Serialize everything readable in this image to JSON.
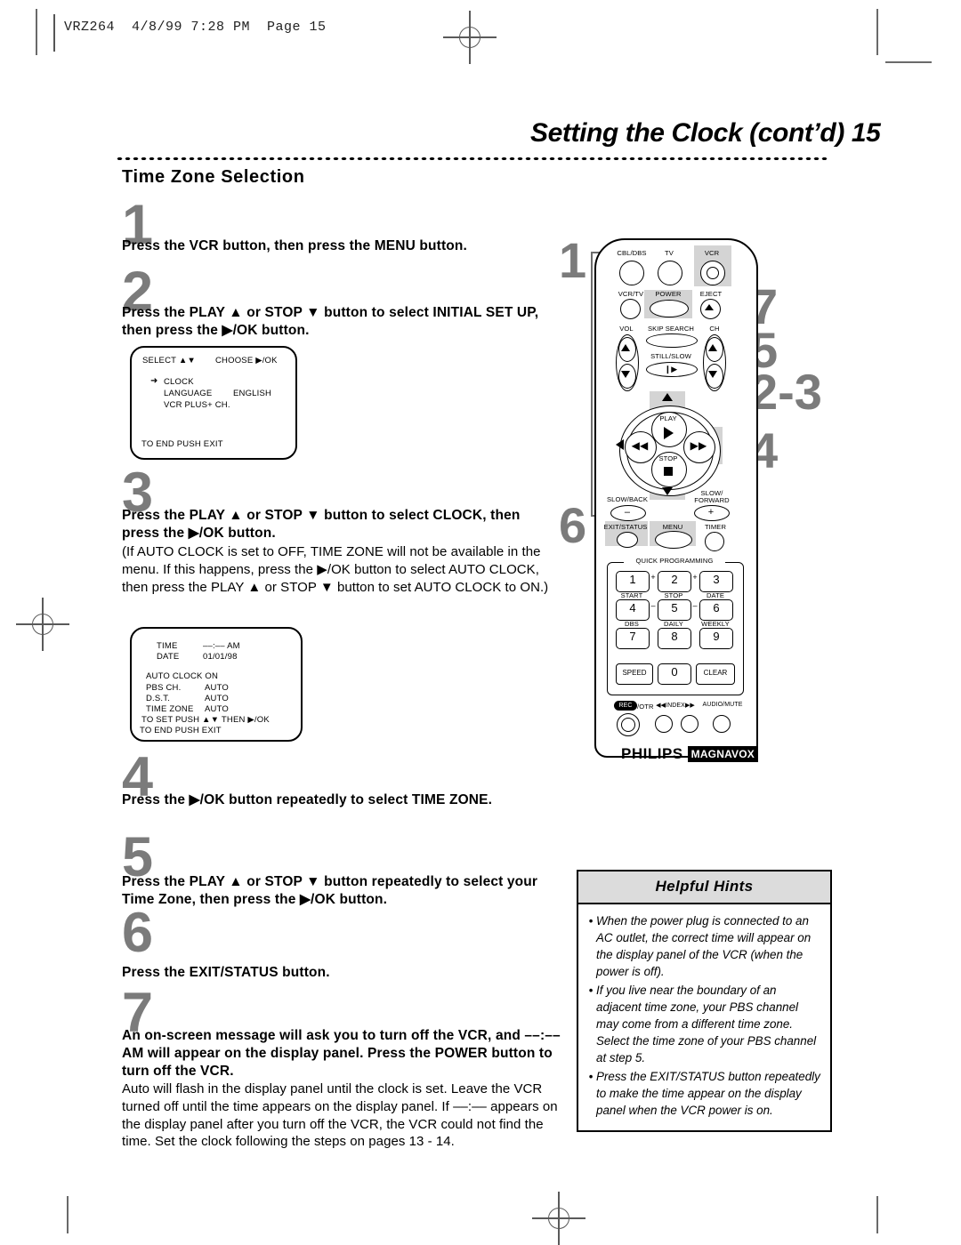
{
  "page": {
    "slug": "VRZ264  4/8/99 7:28 PM  Page 15",
    "title": "Setting the Clock (cont’d)  15",
    "section_heading": "Time Zone Selection"
  },
  "steps": [
    {
      "num": "1",
      "bold": "Press the VCR button, then press the MENU button.",
      "body": ""
    },
    {
      "num": "2",
      "bold": "Press the PLAY ▲ or STOP ▼ button to select INITIAL SET UP, then press the ▶/OK button.",
      "body": ""
    },
    {
      "num": "3",
      "bold": "Press the PLAY ▲ or STOP ▼ button to select CLOCK, then press the ▶/OK button.",
      "body": "(If AUTO CLOCK is set to OFF, TIME ZONE will not be available in the menu. If this happens, press the ▶/OK button to select AUTO CLOCK, then press the PLAY ▲ or STOP ▼ button to set AUTO CLOCK to ON.)"
    },
    {
      "num": "4",
      "bold": "Press the ▶/OK button repeatedly to select TIME ZONE.",
      "body": ""
    },
    {
      "num": "5",
      "bold": "Press the PLAY ▲ or STOP ▼ button repeatedly to select your Time Zone, then press the ▶/OK button.",
      "body": ""
    },
    {
      "num": "6",
      "bold": "Press the EXIT/STATUS button.",
      "body": ""
    },
    {
      "num": "7",
      "bold": "An on-screen message will ask you to turn off the VCR, and ––:–– AM will appear on the display panel. Press the POWER button to turn off the VCR.",
      "body": "Auto will flash in the display panel until the clock is set. Leave the VCR turned off until the time appears on the display panel. If ––:–– appears on the display panel after you turn off the VCR, the VCR could not find the time. Set the clock following the steps on pages 13 - 14."
    }
  ],
  "osd1": {
    "select": "SELECT ▲▼",
    "choose": "CHOOSE ▶/OK",
    "cursor": "➜",
    "item1": "CLOCK",
    "item2": "LANGUAGE",
    "item2_value": "ENGLISH",
    "item3": "VCR PLUS+ CH.",
    "footer": "TO END PUSH EXIT"
  },
  "osd2": {
    "time_label": "TIME",
    "time_value": "––:–– AM",
    "date_label": "DATE",
    "date_value": "01/01/98",
    "auto_clock": "AUTO CLOCK ON",
    "pbs_label": "PBS CH.",
    "pbs_value": "AUTO",
    "dst_label": "D.S.T.",
    "dst_value": "AUTO",
    "tz_label": "TIME ZONE",
    "tz_value": "AUTO",
    "footer1": "TO SET PUSH ▲▼ THEN ▶/OK",
    "footer2": "TO END PUSH EXIT"
  },
  "callouts": {
    "left_top": "1",
    "left_bottom": "6",
    "right": [
      "7",
      "5",
      "2-3",
      "4"
    ]
  },
  "remote": {
    "top_row": [
      "CBL/DBS",
      "TV",
      "VCR"
    ],
    "second_row": [
      "VCR/TV",
      "POWER",
      "EJECT"
    ],
    "vol": "VOL",
    "skip_search": "SKIP SEARCH",
    "ch": "CH",
    "still_slow": "STILL/SLOW",
    "play": "PLAY",
    "ok": "▶/OK",
    "stop": "STOP",
    "slow_back": "SLOW/BACK",
    "slow_back_sign": "–",
    "slow_forward": "SLOW/ FORWARD",
    "slow_forward_sign": "+",
    "exit_status": "EXIT/STATUS",
    "menu": "MENU",
    "timer": "TIMER",
    "quick_programming": "QUICK PROGRAMMING",
    "keys": [
      "1",
      "2",
      "3",
      "4",
      "5",
      "6",
      "7",
      "8",
      "9",
      "0"
    ],
    "key_sublabels": [
      "START",
      "STOP",
      "DATE",
      "DBS",
      "DAILY",
      "WEEKLY"
    ],
    "plus": "+",
    "minus": "–",
    "speed": "SPEED",
    "clear": "CLEAR",
    "rec": "REC",
    "otr": "/OTR",
    "index": "◀◀INDEX▶▶",
    "audio_mute": "AUDIO/MUTE",
    "brand": "PHILIPS",
    "brand2": "MAGNAVOX"
  },
  "hints": {
    "title": "Helpful Hints",
    "bullet": "•",
    "items": [
      "When the power plug is connected to an AC outlet, the correct time will appear on the display panel of the VCR (when the power is off).",
      "If you live near the boundary of an adjacent time zone, your PBS channel may come from a different time zone. Select the time zone of your PBS channel at step 5.",
      "Press the EXIT/STATUS button repeatedly to make the time appear on the display panel when the VCR power is on."
    ]
  },
  "colors": {
    "step_number": "#7b7b7b",
    "highlight": "#d4d4d4",
    "hints_header": "#dcdcdc"
  }
}
